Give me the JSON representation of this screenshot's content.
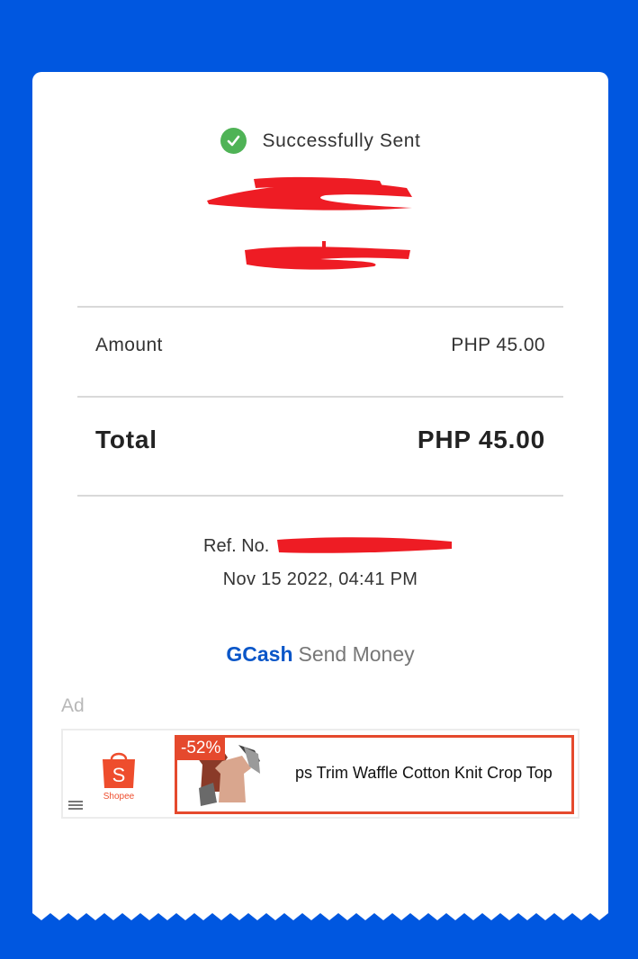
{
  "status": {
    "text": "Successfully Sent",
    "icon": "check-circle-icon",
    "color": "#4fb356"
  },
  "summary": {
    "amount_label": "Amount",
    "amount_value": "PHP 45.00",
    "total_label": "Total",
    "total_value": "PHP 45.00"
  },
  "reference": {
    "label": "Ref. No."
  },
  "timestamp": "Nov 15 2022, 04:41 PM",
  "branding": {
    "brand": "GCash",
    "service": "Send Money"
  },
  "ad": {
    "label": "Ad",
    "advertiser": "Shopee",
    "discount": "-52%",
    "product_name": "ps Trim Waffle Cotton Knit Crop Top"
  },
  "colors": {
    "background": "#0057e0",
    "gcash_blue": "#0a56c8",
    "shopee_orange": "#e5492d",
    "redaction": "#ee1c24"
  }
}
